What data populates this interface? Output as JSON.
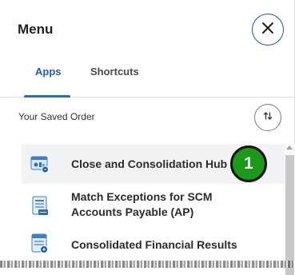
{
  "header": {
    "title": "Menu",
    "close_icon": "close-icon"
  },
  "tabs": [
    {
      "label": "Apps",
      "active": true
    },
    {
      "label": "Shortcuts",
      "active": false
    }
  ],
  "saved_order": {
    "label": "Your Saved Order",
    "sort_icon": "sort-arrows-icon"
  },
  "apps": [
    {
      "label_lines": [
        "Close and Consolidation Hub"
      ],
      "icon": "consolidation-hub-icon",
      "highlighted": true
    },
    {
      "label_lines": [
        "Match Exceptions for SCM",
        "Accounts Payable (AP)"
      ],
      "icon": "report-document-icon",
      "highlighted": false
    },
    {
      "label_lines": [
        "Consolidated Financial Results"
      ],
      "icon": "financial-results-icon",
      "highlighted": false
    }
  ],
  "annotation": {
    "step": "1"
  },
  "colors": {
    "accent": "#1f6fc5",
    "badge": "#1a9a18",
    "highlight_row": "#f2f3f5"
  }
}
